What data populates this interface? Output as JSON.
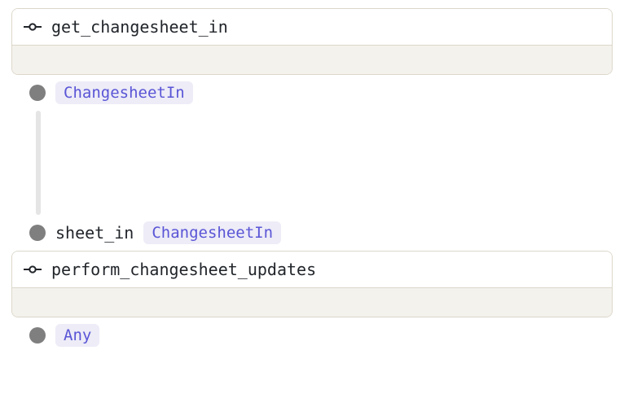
{
  "nodes": [
    {
      "title": "get_changesheet_in",
      "output_port": {
        "label": null,
        "type": "ChangesheetIn"
      }
    },
    {
      "title": "perform_changesheet_updates",
      "input_port": {
        "label": "sheet_in",
        "type": "ChangesheetIn"
      },
      "output_port": {
        "label": null,
        "type": "Any"
      }
    }
  ]
}
